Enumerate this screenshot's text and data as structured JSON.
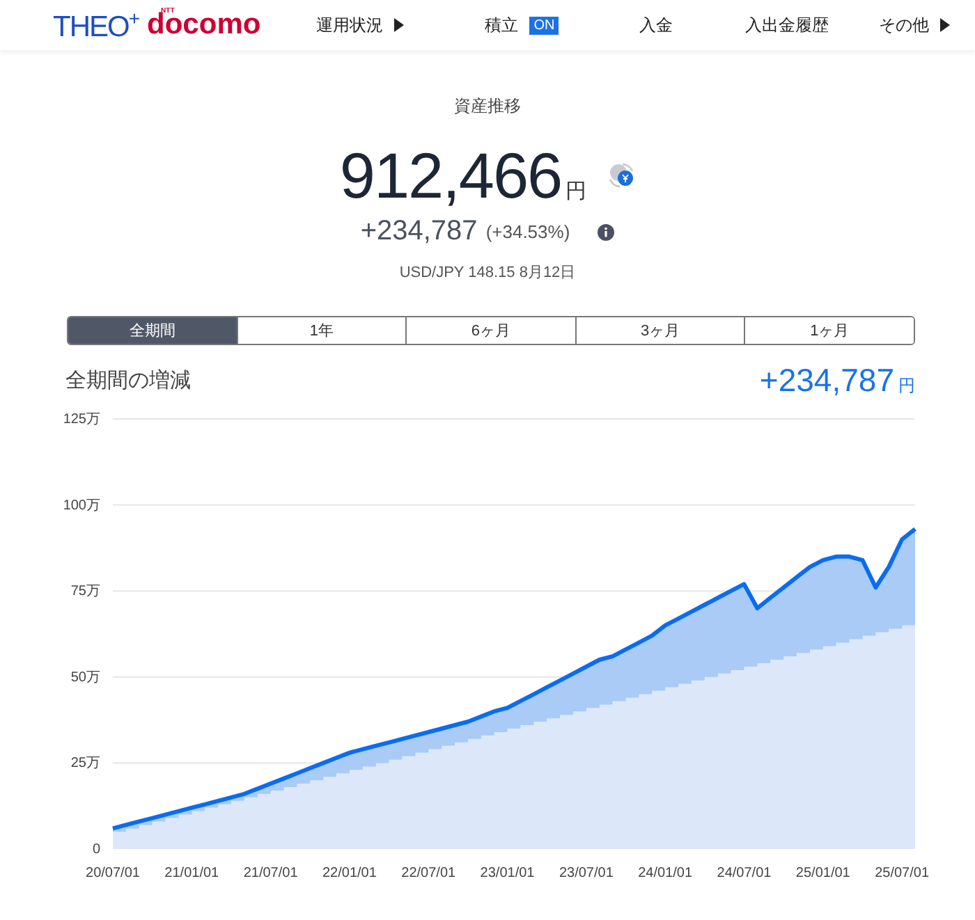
{
  "header": {
    "logo_theo": "THEO",
    "logo_plus": "+",
    "logo_ntt": "NTT",
    "logo_docomo": "docomo",
    "nav": [
      {
        "label": "運用状況",
        "kind": "arrow"
      },
      {
        "label": "積立",
        "kind": "badge",
        "badge": "ON"
      },
      {
        "label": "入金",
        "kind": "plain"
      },
      {
        "label": "入出金履歴",
        "kind": "plain"
      },
      {
        "label": "その他",
        "kind": "arrow"
      }
    ]
  },
  "summary": {
    "title": "資産推移",
    "total": "912,466",
    "total_unit": "円",
    "change": "+234,787",
    "change_pct": "(+34.53%)",
    "rate": "USD/JPY 148.15 8月12日"
  },
  "tabs": [
    {
      "label": "全期間",
      "selected": true
    },
    {
      "label": "1年",
      "selected": false
    },
    {
      "label": "6ヶ月",
      "selected": false
    },
    {
      "label": "3ヶ月",
      "selected": false
    },
    {
      "label": "1ヶ月",
      "selected": false
    }
  ],
  "period": {
    "label": "全期間の増減",
    "value": "+234,787",
    "unit": "円"
  },
  "chart": {
    "chart_data": {
      "type": "area",
      "categories": [
        "20/07/01",
        null,
        null,
        null,
        null,
        null,
        "21/01/01",
        null,
        null,
        null,
        null,
        null,
        "21/07/01",
        null,
        null,
        null,
        null,
        null,
        "22/01/01",
        null,
        null,
        null,
        null,
        null,
        "22/07/01",
        null,
        null,
        null,
        null,
        null,
        "23/01/01",
        null,
        null,
        null,
        null,
        null,
        "23/07/01",
        null,
        null,
        null,
        null,
        null,
        "24/01/01",
        null,
        null,
        null,
        null,
        null,
        "24/07/01",
        null,
        null,
        null,
        null,
        null,
        "25/01/01",
        null,
        null,
        null,
        null,
        null,
        "25/07/01",
        null
      ],
      "series": [
        {
          "color": "#0a6cf0",
          "values": [
            6,
            7,
            8,
            9,
            10,
            11,
            12,
            13,
            14,
            15,
            16,
            17.5,
            19,
            20.5,
            22,
            23.5,
            25,
            26.5,
            28,
            29,
            30,
            31,
            32,
            33,
            34,
            35,
            36,
            37,
            38.5,
            40,
            41,
            43,
            45,
            47,
            49,
            51,
            53,
            55,
            56,
            58,
            60,
            62,
            65,
            67,
            69,
            71,
            73,
            75,
            77,
            70,
            73,
            76,
            79,
            82,
            84,
            85,
            85,
            84,
            76,
            82,
            90,
            93
          ]
        },
        {
          "color": "#dce8fa",
          "values": [
            5,
            6,
            7,
            8,
            9,
            10,
            11,
            12,
            13,
            14,
            15,
            16,
            17,
            18,
            19,
            20,
            21,
            22,
            23,
            24,
            25,
            26,
            27,
            28,
            29,
            30,
            31,
            32,
            33,
            34,
            35,
            36,
            37,
            38,
            39,
            40,
            41,
            42,
            43,
            44,
            45,
            46,
            47,
            48,
            49,
            50,
            51,
            52,
            53,
            54,
            55,
            56,
            57,
            58,
            59,
            60,
            61,
            62,
            63,
            64,
            65,
            66
          ]
        }
      ],
      "ylim": [
        0,
        125
      ],
      "grid": true,
      "yticks": [
        {
          "value": 0,
          "label": "0"
        },
        {
          "value": 25,
          "label": "25万"
        },
        {
          "value": 50,
          "label": "50万"
        },
        {
          "value": 75,
          "label": "75万"
        },
        {
          "value": 100,
          "label": "100万"
        },
        {
          "value": 125,
          "label": "125万"
        }
      ]
    }
  }
}
